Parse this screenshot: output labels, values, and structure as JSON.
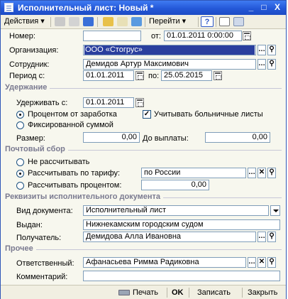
{
  "window": {
    "title": "Исполнительный лист: Новый *",
    "min": "_",
    "max": "□",
    "close": "X"
  },
  "toolbar": {
    "actions": "Действия ▾",
    "goto": "Перейти ▾",
    "help": "?"
  },
  "form": {
    "nomer_label": "Номер:",
    "nomer_value": "",
    "ot_label": "от:",
    "ot_value": "01.01.2011  0:00:00",
    "org_label": "Организация:",
    "org_value": "ООО «Стогрус»",
    "sotr_label": "Сотрудник:",
    "sotr_value": "Демидов Артур Максимович",
    "period_label": "Период с:",
    "period_from": "01.01.2011",
    "period_to_label": "по:",
    "period_to": "25.05.2015"
  },
  "uderzhanie": {
    "section": "Удержание",
    "from_label": "Удерживать с:",
    "from_value": "01.01.2011",
    "radio1": "Процентом от заработка",
    "check1": "Учитывать больничные листы",
    "radio2": "Фиксированной суммой",
    "razmer_label": "Размер:",
    "razmer_value": "0,00",
    "do_label": "До выплаты:",
    "do_value": "0,00"
  },
  "pochta": {
    "section": "Почтовый сбор",
    "radio1": "Не рассчитывать",
    "radio2": "Рассчитывать по тарифу:",
    "tarif_value": "по России",
    "radio3": "Рассчитывать процентом:",
    "percent_value": "0,00"
  },
  "rekvizity": {
    "section": "Реквизиты исполнительного документа",
    "vid_label": "Вид документа:",
    "vid_value": "Исполнительный лист",
    "vydan_label": "Выдан:",
    "vydan_value": "Нижнекамским городским судом",
    "poluch_label": "Получатель:",
    "poluch_value": "Демидова Алла Ивановна"
  },
  "prochee": {
    "section": "Прочее",
    "otv_label": "Ответственный:",
    "otv_value": "Афанасьева Римма Радиковна",
    "comm_label": "Комментарий:",
    "comm_value": ""
  },
  "footer": {
    "print": "Печать",
    "ok": "OK",
    "save": "Записать",
    "close": "Закрыть"
  },
  "colors": {
    "title_bar": "#2458d8",
    "selection": "#2a3f9e",
    "section_text": "#7a7a90"
  }
}
